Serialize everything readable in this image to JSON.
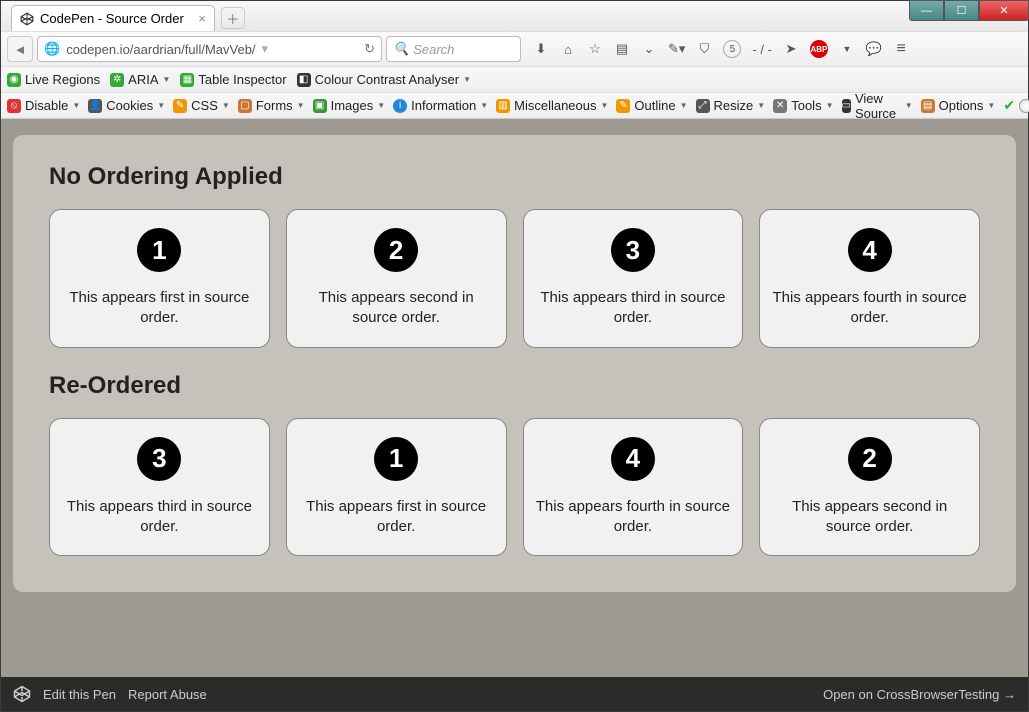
{
  "window": {
    "tab_title": "CodePen - Source Order",
    "url": "codepen.io/aardrian/full/MavVeb/",
    "search_placeholder": "Search"
  },
  "nav_icons": {
    "counter_value": "5",
    "slash_label": "- / -",
    "abp_label": "ABP"
  },
  "toolbar1": {
    "live_regions": "Live Regions",
    "aria": "ARIA",
    "table_inspector": "Table Inspector",
    "colour_contrast": "Colour Contrast Analyser"
  },
  "toolbar2": {
    "disable": "Disable",
    "cookies": "Cookies",
    "css": "CSS",
    "forms": "Forms",
    "images": "Images",
    "information": "Information",
    "misc": "Miscellaneous",
    "outline": "Outline",
    "resize": "Resize",
    "tools": "Tools",
    "view_source": "View Source",
    "options": "Options"
  },
  "content": {
    "heading1": "No Ordering Applied",
    "heading2": "Re-Ordered",
    "row1": [
      {
        "num": "1",
        "text": "This appears first in source order."
      },
      {
        "num": "2",
        "text": "This appears second in source order."
      },
      {
        "num": "3",
        "text": "This appears third in source order."
      },
      {
        "num": "4",
        "text": "This appears fourth in source order."
      }
    ],
    "row2": [
      {
        "num": "3",
        "text": "This appears third in source order."
      },
      {
        "num": "1",
        "text": "This appears first in source order."
      },
      {
        "num": "4",
        "text": "This appears fourth in source order."
      },
      {
        "num": "2",
        "text": "This appears second in source order."
      }
    ]
  },
  "footer": {
    "edit": "Edit this Pen",
    "report": "Report Abuse",
    "open_cbt": "Open on CrossBrowserTesting →"
  }
}
